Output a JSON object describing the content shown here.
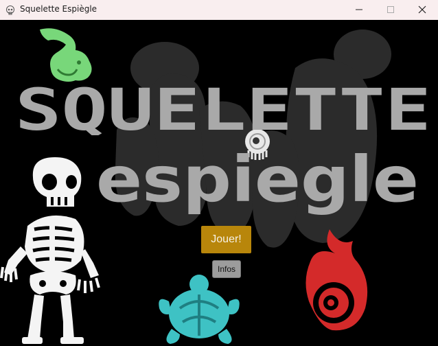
{
  "window": {
    "title": "Squelette Espiègle",
    "app_icon": "skull-icon",
    "minimize_icon": "minimize-icon",
    "maximize_icon": "maximize-icon",
    "close_icon": "close-icon"
  },
  "logo": {
    "line1": "SQUELETTE",
    "line2": "espiegle",
    "color": "#a9a9a9"
  },
  "menu": {
    "play_label": "Jouer!",
    "info_label": "Infos"
  },
  "colors": {
    "play_button": "#b8860b",
    "info_button": "#9c9c9c",
    "background": "#000000",
    "dragon": "#78d77a",
    "turtle": "#3ec2c4",
    "flame": "#d42a2a"
  },
  "decorations": [
    "dragon-sprite",
    "skeleton-sprite",
    "eyeball-sprite",
    "turtle-sprite",
    "flame-eye-sprite",
    "bubble-silhouette"
  ]
}
